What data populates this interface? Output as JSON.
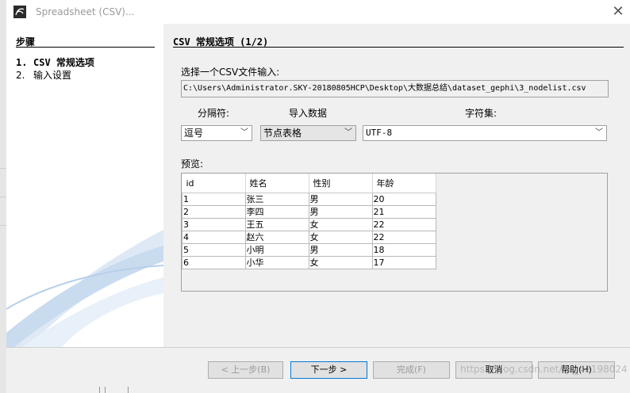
{
  "window": {
    "title": "Spreadsheet (CSV)..."
  },
  "steps": {
    "heading": "步骤",
    "items": [
      {
        "num": "1.",
        "label": "CSV 常规选项"
      },
      {
        "num": "2.",
        "label": "输入设置"
      }
    ]
  },
  "main": {
    "title": "CSV 常规选项 (1/2)",
    "file_label": "选择一个CSV文件输入:",
    "file_path": "C:\\Users\\Administrator.SKY-20180805HCP\\Desktop\\大数据总结\\dataset_gephi\\3_nodelist.csv",
    "separator_label": "分隔符:",
    "import_label": "导入数据",
    "charset_label": "字符集:",
    "separator_value": "逗号",
    "import_value": "节点表格",
    "charset_value": "UTF-8",
    "preview_label": "预览:",
    "preview": {
      "headers": [
        "id",
        "姓名",
        "性别",
        "年龄"
      ],
      "rows": [
        [
          "1",
          "张三",
          "男",
          "20"
        ],
        [
          "2",
          "李四",
          "男",
          "21"
        ],
        [
          "3",
          "王五",
          "女",
          "22"
        ],
        [
          "4",
          "赵六",
          "女",
          "22"
        ],
        [
          "5",
          "小明",
          "男",
          "18"
        ],
        [
          "6",
          "小华",
          "女",
          "17"
        ]
      ]
    }
  },
  "buttons": {
    "back": "< 上一步(B)",
    "next": "下一步 >",
    "finish": "完成(F)",
    "cancel": "取消",
    "help": "帮助(H)"
  },
  "watermark": "https://blog.csdn.net/qq_42198024"
}
